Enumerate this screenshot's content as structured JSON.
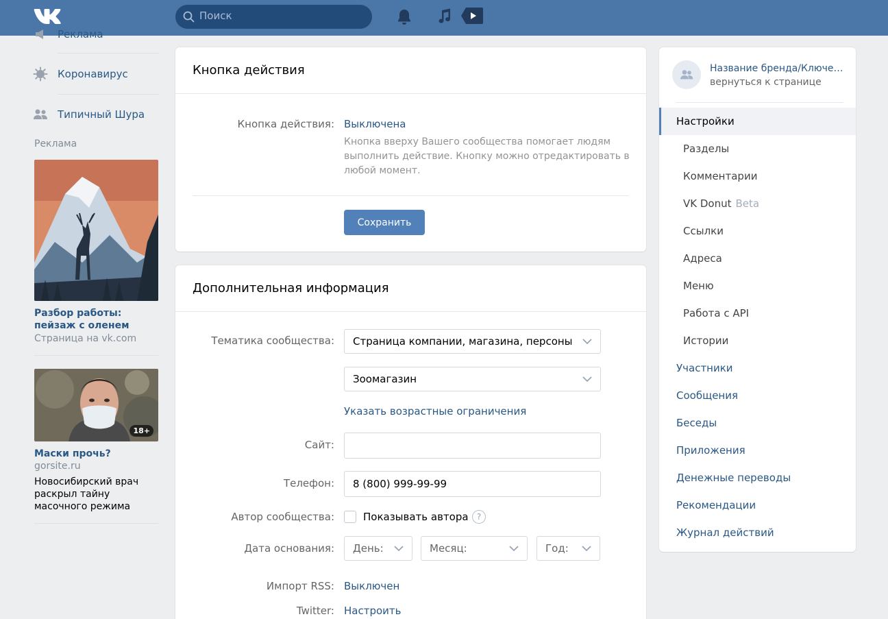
{
  "header": {
    "search_placeholder": "Поиск"
  },
  "left": {
    "items": [
      {
        "label": "Реклама",
        "icon": "megaphone-icon"
      },
      {
        "label": "Коронавирус",
        "icon": "virus-icon"
      },
      {
        "label": "Типичный Шура",
        "icon": "group-icon"
      }
    ],
    "ads_title": "Реклама",
    "ads": [
      {
        "title": "Разбор работы: пейзаж с оленем",
        "sub": "Страница на vk.com"
      },
      {
        "title": "Маски прочь?",
        "sub": "gorsite.ru",
        "text": "Новосибирский врач раскрыл тайну масочного режима",
        "badge": "18+"
      }
    ]
  },
  "action_card": {
    "title": "Кнопка действия",
    "label": "Кнопка действия:",
    "value": "Выключена",
    "description": "Кнопка вверху Вашего сообщества помогает людям выполнить действие. Кнопку можно отредактировать в любой момент.",
    "save_label": "Сохранить"
  },
  "info_card": {
    "title": "Дополнительная информация",
    "theme_label": "Тематика сообщества:",
    "theme_value": "Страница компании, магазина, персоны",
    "subtheme_value": "Зоомагазин",
    "age_link": "Указать возрастные ограничения",
    "site_label": "Сайт:",
    "site_value": "",
    "phone_label": "Телефон:",
    "phone_value": "8 (800) 999-99-99",
    "author_label": "Автор сообщества:",
    "author_checkbox": "Показывать автора",
    "author_help": "?",
    "date_label": "Дата основания:",
    "day_placeholder": "День:",
    "month_placeholder": "Месяц:",
    "year_placeholder": "Год:",
    "rss_label": "Импорт RSS:",
    "rss_value": "Выключен",
    "twitter_label": "Twitter:",
    "twitter_value": "Настроить"
  },
  "right_menu": {
    "brand_name": "Название бренда/Ключевое слово",
    "brand_back": "вернуться к странице",
    "items": [
      {
        "label": "Настройки"
      },
      {
        "label": "Разделы"
      },
      {
        "label": "Комментарии"
      },
      {
        "label": "VK Donut",
        "extra": "Beta"
      },
      {
        "label": "Ссылки"
      },
      {
        "label": "Адреса"
      },
      {
        "label": "Меню"
      },
      {
        "label": "Работа с API"
      },
      {
        "label": "Истории"
      },
      {
        "label": "Участники"
      },
      {
        "label": "Сообщения"
      },
      {
        "label": "Беседы"
      },
      {
        "label": "Приложения"
      },
      {
        "label": "Денежные переводы"
      },
      {
        "label": "Рекомендации"
      },
      {
        "label": "Журнал действий"
      }
    ]
  },
  "colors": {
    "header": "#4a76a8",
    "link": "#2a5885",
    "button": "#5181b8",
    "background": "#edeef0"
  }
}
